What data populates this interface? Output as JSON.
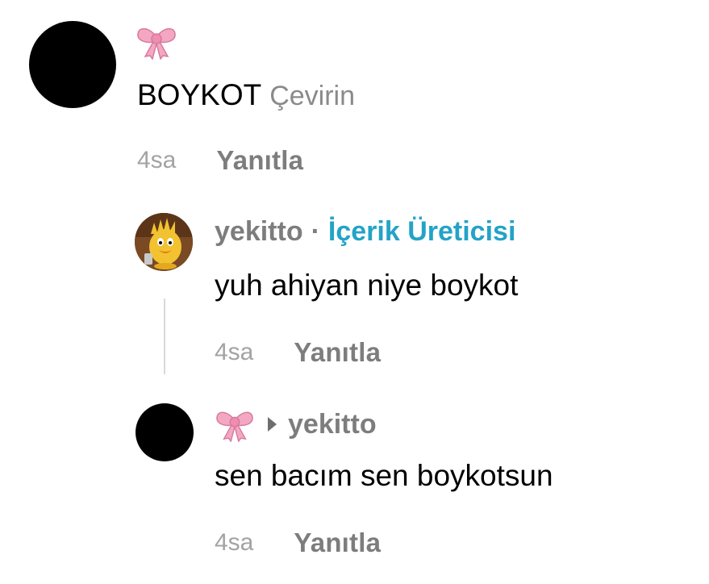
{
  "comment1": {
    "user_emoji": "bow-emoji",
    "text": "BOYKOT",
    "translate_label": "Çevirin",
    "time": "4sa",
    "reply_label": "Yanıtla"
  },
  "reply1": {
    "username": "yekitto",
    "separator": "·",
    "creator_badge": "İçerik Üreticisi",
    "text": "yuh ahiyan niye boykot",
    "time": "4sa",
    "reply_label": "Yanıtla"
  },
  "reply2": {
    "user_emoji": "bow-emoji",
    "replying_to": "yekitto",
    "text": "sen bacım sen boykotsun",
    "time": "4sa",
    "reply_label": "Yanıtla"
  },
  "colors": {
    "creator_accent": "#23a3c7",
    "muted_text": "#7d7d7d",
    "timestamp": "#a3a3a3",
    "bow_pink": "#f4a7c3"
  }
}
